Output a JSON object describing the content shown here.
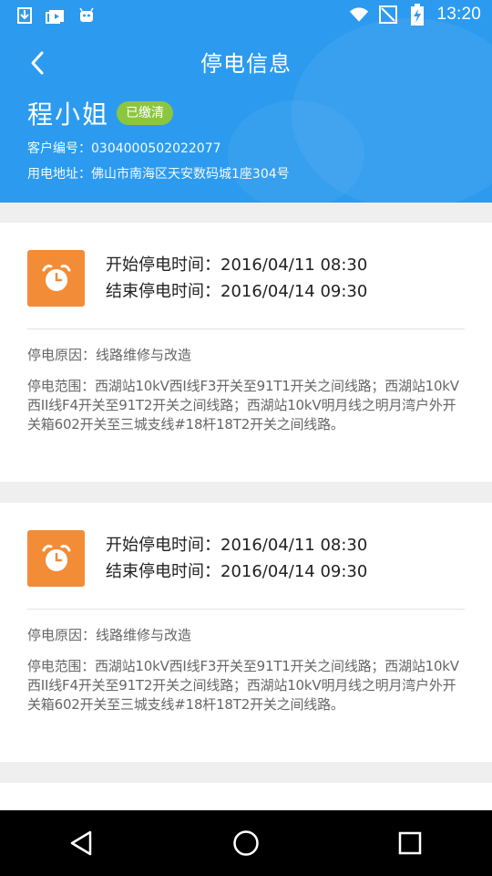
{
  "status_bar": {
    "time": "13:20",
    "icons_left": [
      "download-icon",
      "media-icon",
      "android-icon"
    ],
    "icons_right": [
      "wifi-icon",
      "no-sim-icon",
      "battery-charging-icon"
    ]
  },
  "header": {
    "title": "停电信息",
    "back_icon": "chevron-left-icon",
    "customer_name": "程小姐",
    "paid_badge": "已缴清",
    "customer_number": "客户编号：0304000502022077",
    "address": "用电地址：佛山市南海区天安数码城1座304号",
    "colors": {
      "header_bg": "#2c9bef",
      "badge_bg": "#8cc63f"
    }
  },
  "outages": [
    {
      "start": "开始停电时间：2016/04/11 08:30",
      "end": "结束停电时间：2016/04/14 09:30",
      "reason": "停电原因：线路维修与改造",
      "scope": "停电范围：西湖站10kV西I线F3开关至91T1开关之间线路；西湖站10kV西II线F4开关至91T2开关之间线路；西湖站10kV明月线之明月湾户外开关箱602开关至三城支线#18杆18T2开关之间线路。"
    },
    {
      "start": "开始停电时间：2016/04/11 08:30",
      "end": "结束停电时间：2016/04/14 09:30",
      "reason": "停电原因：线路维修与改造",
      "scope": "停电范围：西湖站10kV西I线F3开关至91T1开关之间线路；西湖站10kV西II线F4开关至91T2开关之间线路；西湖站10kV明月线之明月湾户外开关箱602开关至三城支线#18杆18T2开关之间线路。"
    }
  ],
  "card_icon": "alarm-clock-icon",
  "card_icon_color": "#f28c37",
  "nav_buttons": [
    "back-triangle-icon",
    "home-circle-icon",
    "recents-square-icon"
  ]
}
